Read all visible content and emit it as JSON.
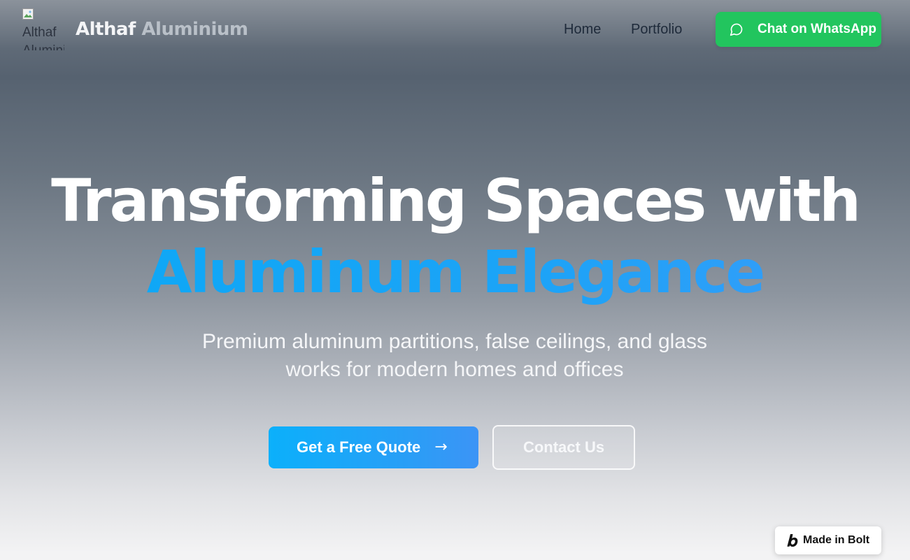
{
  "header": {
    "logo_alt": "Althaf Aluminium",
    "brand_first": "Althaf",
    "brand_second": "Aluminium",
    "nav": {
      "home": "Home",
      "portfolio": "Portfolio"
    },
    "whatsapp": {
      "label": "Chat on WhatsApp",
      "icon": "message-circle-icon",
      "color": "#22c55e"
    }
  },
  "hero": {
    "title_line_1": "Transforming Spaces with",
    "title_line_2": "Aluminum Elegance",
    "subtitle": "Premium aluminum partitions, false ceilings, and glass works for modern homes and offices",
    "accent_color": "#0ea5e9",
    "primary_cta": {
      "label": "Get a Free Quote",
      "icon": "arrow-right-icon",
      "arrow": "→"
    },
    "secondary_cta": {
      "label": "Contact Us"
    }
  },
  "badge": {
    "label": "Made in Bolt",
    "icon": "bolt-logo-icon"
  }
}
